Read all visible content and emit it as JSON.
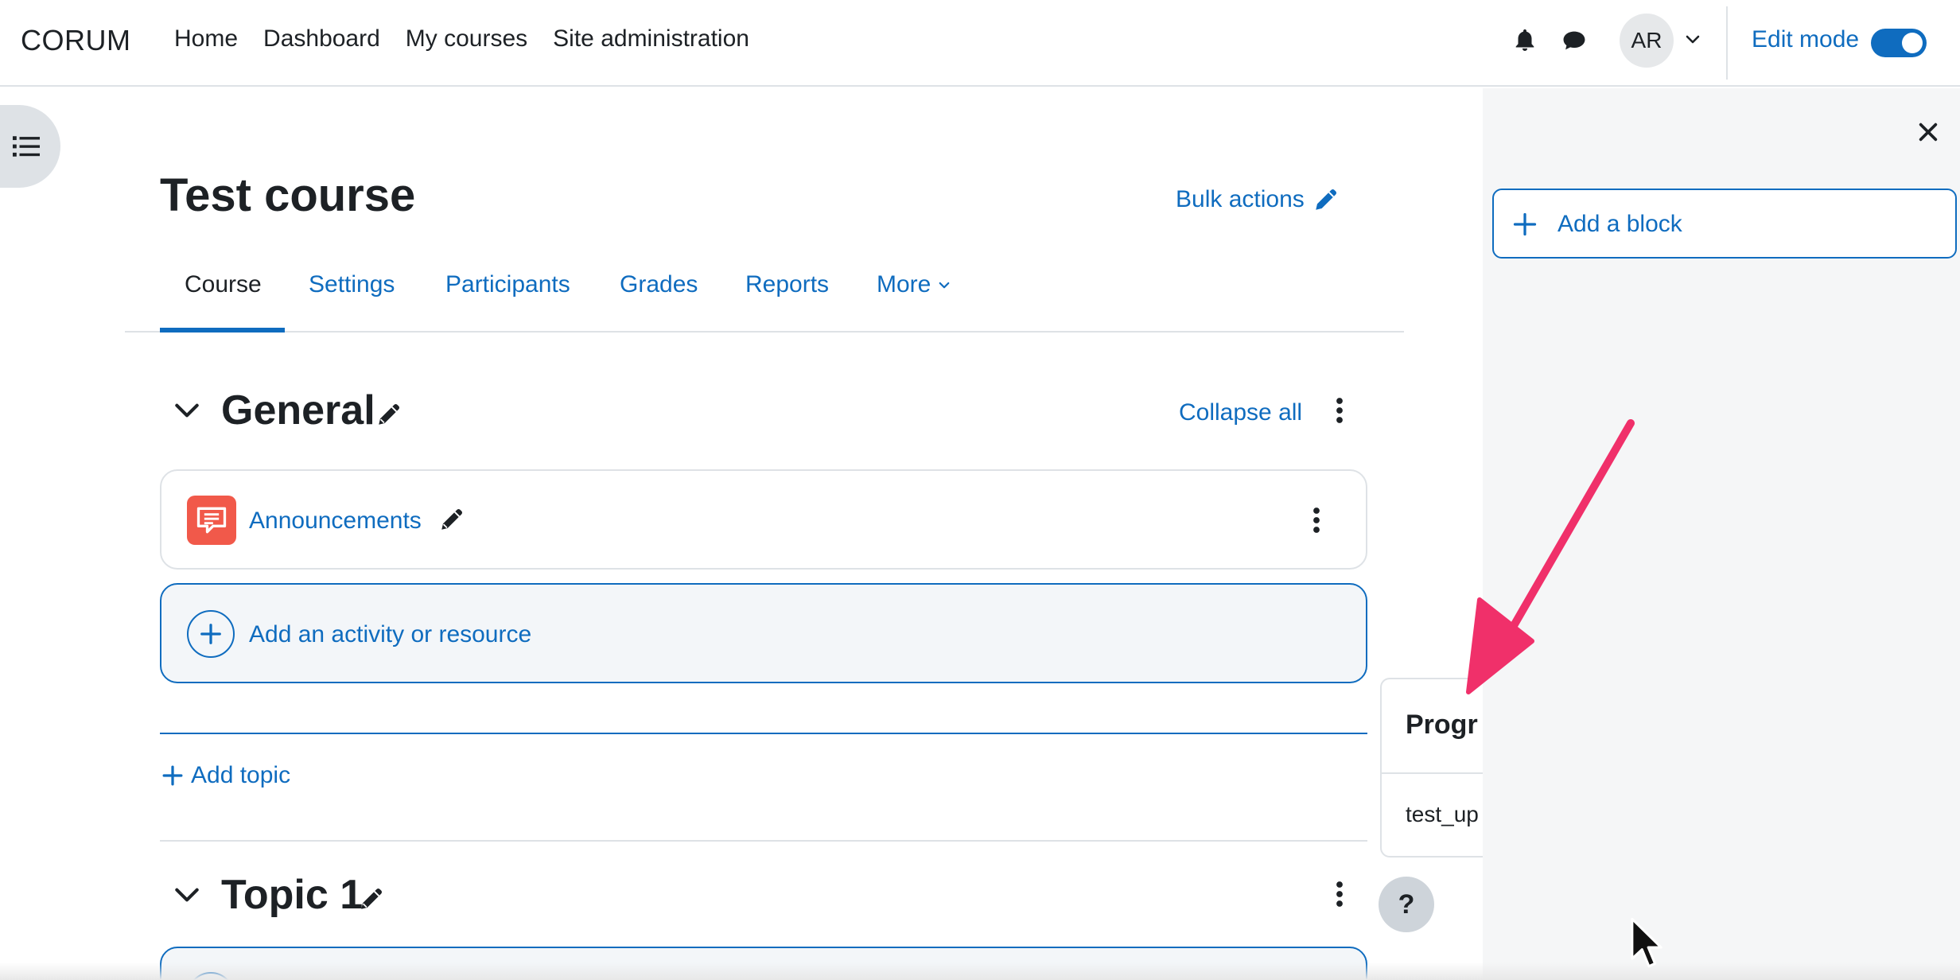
{
  "navbar": {
    "brand": "CORUM",
    "links": [
      "Home",
      "Dashboard",
      "My courses",
      "Site administration"
    ],
    "avatar_initials": "AR",
    "edit_mode_label": "Edit mode",
    "edit_mode_on": true
  },
  "course": {
    "title": "Test course",
    "bulk_actions": "Bulk actions",
    "tabs": [
      "Course",
      "Settings",
      "Participants",
      "Grades",
      "Reports",
      "More"
    ],
    "active_tab": "Course"
  },
  "sections": {
    "general": {
      "title": "General",
      "collapse_all": "Collapse all",
      "activities": [
        {
          "name": "Announcements",
          "icon": "forum-icon"
        }
      ],
      "add_activity": "Add an activity or resource"
    },
    "add_topic": "Add topic",
    "topic1": {
      "title": "Topic 1"
    }
  },
  "block_drawer": {
    "add_block": "Add a block"
  },
  "progress_popover": {
    "title": "Progr",
    "item": "test_up"
  },
  "help_button": "?",
  "colors": {
    "accent": "#0f6cbf",
    "text": "#1d2125",
    "forum_icon": "#f1594a",
    "annotation_arrow": "#f0306a"
  }
}
